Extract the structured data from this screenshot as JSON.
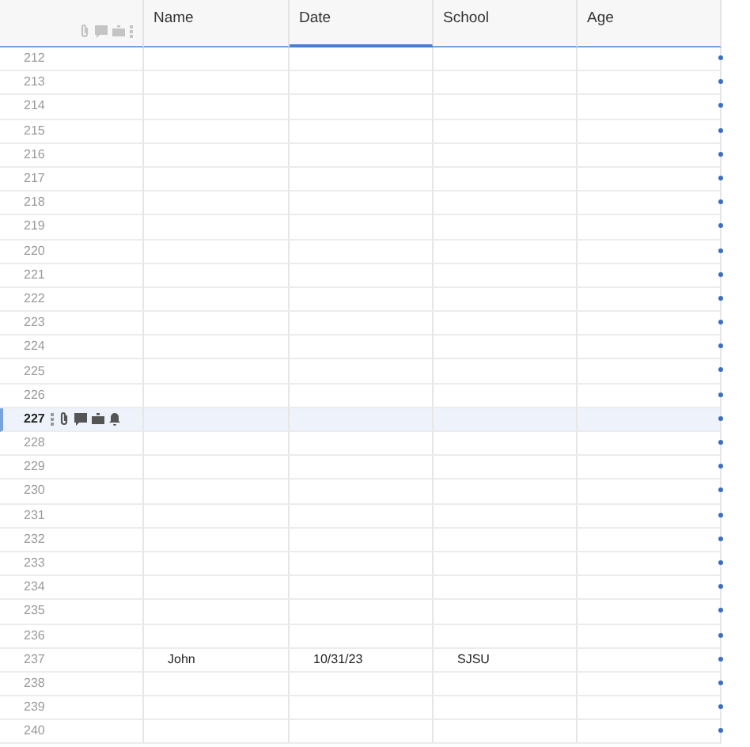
{
  "table": {
    "columns": [
      {
        "label": "Name",
        "selected": false
      },
      {
        "label": "Date",
        "selected": true
      },
      {
        "label": "School",
        "selected": false
      },
      {
        "label": "Age",
        "selected": false
      }
    ],
    "rows": [
      {
        "number": "212",
        "selected": false,
        "cells": [
          "",
          "",
          "",
          ""
        ]
      },
      {
        "number": "213",
        "selected": false,
        "cells": [
          "",
          "",
          "",
          ""
        ]
      },
      {
        "number": "214",
        "selected": false,
        "cells": [
          "",
          "",
          "",
          ""
        ]
      },
      {
        "number": "215",
        "selected": false,
        "cells": [
          "",
          "",
          "",
          ""
        ]
      },
      {
        "number": "216",
        "selected": false,
        "cells": [
          "",
          "",
          "",
          ""
        ]
      },
      {
        "number": "217",
        "selected": false,
        "cells": [
          "",
          "",
          "",
          ""
        ]
      },
      {
        "number": "218",
        "selected": false,
        "cells": [
          "",
          "",
          "",
          ""
        ]
      },
      {
        "number": "219",
        "selected": false,
        "cells": [
          "",
          "",
          "",
          ""
        ]
      },
      {
        "number": "220",
        "selected": false,
        "cells": [
          "",
          "",
          "",
          ""
        ]
      },
      {
        "number": "221",
        "selected": false,
        "cells": [
          "",
          "",
          "",
          ""
        ]
      },
      {
        "number": "222",
        "selected": false,
        "cells": [
          "",
          "",
          "",
          ""
        ]
      },
      {
        "number": "223",
        "selected": false,
        "cells": [
          "",
          "",
          "",
          ""
        ]
      },
      {
        "number": "224",
        "selected": false,
        "cells": [
          "",
          "",
          "",
          ""
        ]
      },
      {
        "number": "225",
        "selected": false,
        "cells": [
          "",
          "",
          "",
          ""
        ]
      },
      {
        "number": "226",
        "selected": false,
        "cells": [
          "",
          "",
          "",
          ""
        ]
      },
      {
        "number": "227",
        "selected": true,
        "cells": [
          "",
          "",
          "",
          ""
        ]
      },
      {
        "number": "228",
        "selected": false,
        "cells": [
          "",
          "",
          "",
          ""
        ]
      },
      {
        "number": "229",
        "selected": false,
        "cells": [
          "",
          "",
          "",
          ""
        ]
      },
      {
        "number": "230",
        "selected": false,
        "cells": [
          "",
          "",
          "",
          ""
        ]
      },
      {
        "number": "231",
        "selected": false,
        "cells": [
          "",
          "",
          "",
          ""
        ]
      },
      {
        "number": "232",
        "selected": false,
        "cells": [
          "",
          "",
          "",
          ""
        ]
      },
      {
        "number": "233",
        "selected": false,
        "cells": [
          "",
          "",
          "",
          ""
        ]
      },
      {
        "number": "234",
        "selected": false,
        "cells": [
          "",
          "",
          "",
          ""
        ]
      },
      {
        "number": "235",
        "selected": false,
        "cells": [
          "",
          "",
          "",
          ""
        ]
      },
      {
        "number": "236",
        "selected": false,
        "cells": [
          "",
          "",
          "",
          ""
        ]
      },
      {
        "number": "237",
        "selected": false,
        "cells": [
          "John",
          "10/31/23",
          "SJSU",
          ""
        ]
      },
      {
        "number": "238",
        "selected": false,
        "cells": [
          "",
          "",
          "",
          ""
        ]
      },
      {
        "number": "239",
        "selected": false,
        "cells": [
          "",
          "",
          "",
          ""
        ]
      },
      {
        "number": "240",
        "selected": false,
        "cells": [
          "",
          "",
          "",
          ""
        ]
      }
    ]
  }
}
